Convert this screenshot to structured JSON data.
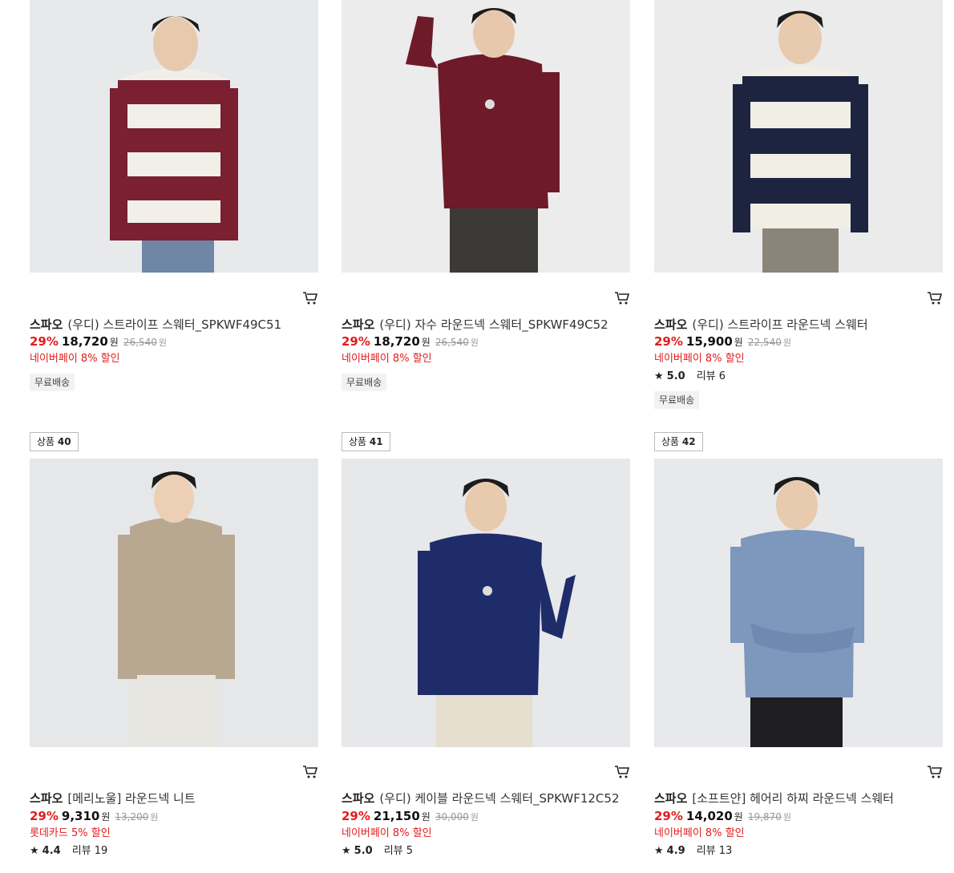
{
  "icons": {
    "cart": "cart-icon",
    "star": "star-icon"
  },
  "colors": {
    "discount": "#e21c1c"
  },
  "products": [
    {
      "badge": null,
      "brand": "스파오",
      "name": "(우디) 스트라이프 스웨터_SPKWF49C51",
      "discount": "29%",
      "price": "18,720",
      "won": "원",
      "original": "26,540",
      "original_won": "원",
      "promo": "네이버페이 8% 할인",
      "rating": null,
      "reviews": null,
      "shipping": "무료배송"
    },
    {
      "badge": null,
      "brand": "스파오",
      "name": "(우디) 자수 라운드넥 스웨터_SPKWF49C52",
      "discount": "29%",
      "price": "18,720",
      "won": "원",
      "original": "26,540",
      "original_won": "원",
      "promo": "네이버페이 8% 할인",
      "rating": null,
      "reviews": null,
      "shipping": "무료배송"
    },
    {
      "badge": null,
      "brand": "스파오",
      "name": "(우디) 스트라이프 라운드넥 스웨터",
      "discount": "29%",
      "price": "15,900",
      "won": "원",
      "original": "22,540",
      "original_won": "원",
      "promo": "네이버페이 8% 할인",
      "rating": "5.0",
      "reviews": "리뷰 6",
      "shipping": "무료배송"
    },
    {
      "badge": {
        "prefix": "상품",
        "num": "40"
      },
      "brand": "스파오",
      "name": "[메리노울] 라운드넥 니트",
      "discount": "29%",
      "price": "9,310",
      "won": "원",
      "original": "13,200",
      "original_won": "원",
      "promo": "롯데카드 5% 할인",
      "rating": "4.4",
      "reviews": "리뷰 19",
      "shipping": null
    },
    {
      "badge": {
        "prefix": "상품",
        "num": "41"
      },
      "brand": "스파오",
      "name": "(우디) 케이블 라운드넥 스웨터_SPKWF12C52",
      "discount": "29%",
      "price": "21,150",
      "won": "원",
      "original": "30,000",
      "original_won": "원",
      "promo": "네이버페이 8% 할인",
      "rating": "5.0",
      "reviews": "리뷰 5",
      "shipping": null
    },
    {
      "badge": {
        "prefix": "상품",
        "num": "42"
      },
      "brand": "스파오",
      "name": "[소프트얀] 헤어리 하찌 라운드넥 스웨터",
      "discount": "29%",
      "price": "14,020",
      "won": "원",
      "original": "19,870",
      "original_won": "원",
      "promo": "네이버페이 8% 할인",
      "rating": "4.9",
      "reviews": "리뷰 13",
      "shipping": null
    }
  ]
}
